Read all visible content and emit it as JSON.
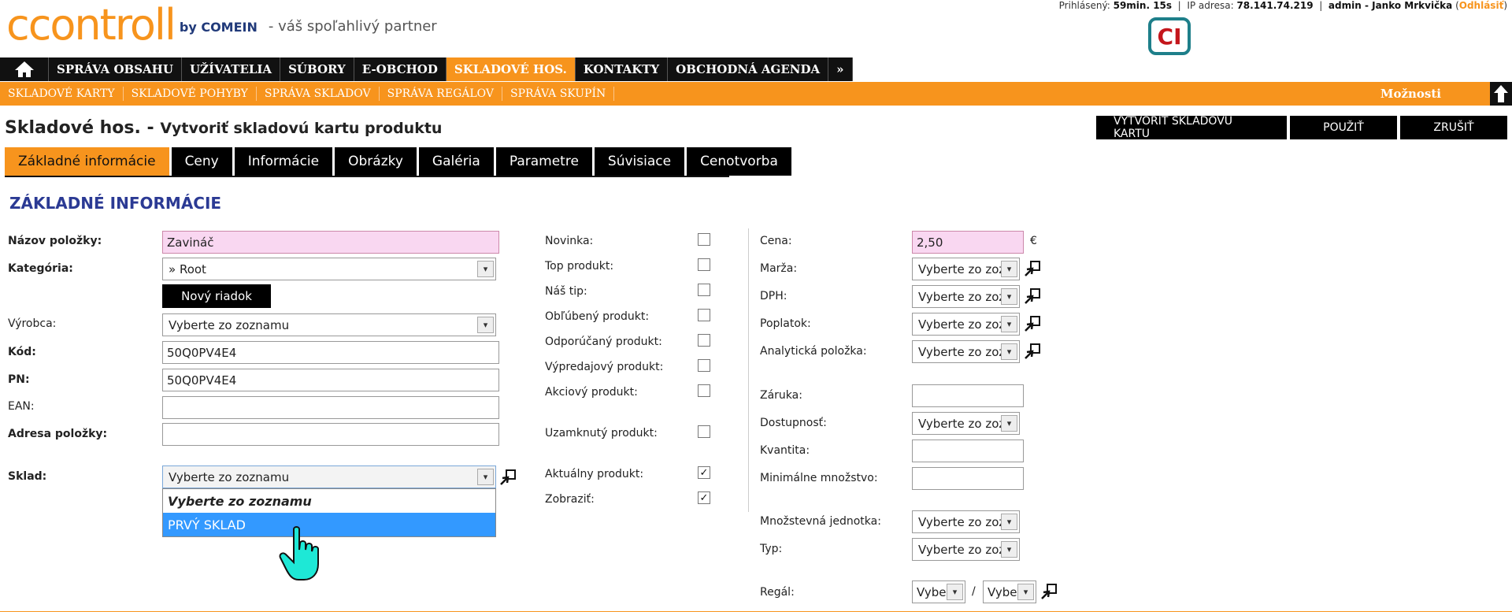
{
  "header": {
    "logo_main": "ccontroll",
    "logo_by": "by COMEIN",
    "slogan": "- váš spoľahlivý partner",
    "session_prefix": "Prihlásený:",
    "session_time": "59min. 15s",
    "ip_label": "IP adresa:",
    "ip_value": "78.141.74.219",
    "user_label": "admin - Janko Mrkvička",
    "logout": "Odhlásiť",
    "ci_logo": "CI"
  },
  "main_nav": [
    "SPRÁVA OBSAHU",
    "UŽÍVATELIA",
    "SÚBORY",
    "E-OBCHOD",
    "SKLADOVÉ HOS.",
    "KONTAKTY",
    "OBCHODNÁ AGENDA",
    "»"
  ],
  "sub_nav": [
    "SKLADOVÉ KARTY",
    "SKLADOVÉ POHYBY",
    "SPRÁVA SKLADOV",
    "SPRÁVA REGÁLOV",
    "SPRÁVA SKUPÍN"
  ],
  "options_label": "Možnosti",
  "page_title": {
    "main": "Skladové hos. -",
    "sub": "Vytvoriť skladovú kartu produktu"
  },
  "actions": {
    "create": "VYTVORIŤ SKLADOVÚ KARTU",
    "apply": "POUŽIŤ",
    "cancel": "ZRUŠIŤ"
  },
  "tabs": [
    "Základné informácie",
    "Ceny",
    "Informácie",
    "Obrázky",
    "Galéria",
    "Parametre",
    "Súvisiace",
    "Cenotvorba"
  ],
  "section_title": "ZÁKLADNÉ INFORMÁCIE",
  "left_form": {
    "name_label": "Názov položky:",
    "name_value": "Zavináč",
    "category_label": "Kategória:",
    "category_value": "» Root",
    "new_row_button": "Nový riadok",
    "manufacturer_label": "Výrobca:",
    "manufacturer_value": "Vyberte zo zoznamu",
    "code_label": "Kód:",
    "code_value": "50Q0PV4E4",
    "pn_label": "PN:",
    "pn_value": "50Q0PV4E4",
    "ean_label": "EAN:",
    "ean_value": "",
    "address_label": "Adresa položky:",
    "address_value": "",
    "warehouse_label": "Sklad:",
    "warehouse_value": "Vyberte zo zoznamu",
    "warehouse_options": [
      "Vyberte zo zoznamu",
      "PRVÝ SKLAD"
    ]
  },
  "flags": [
    {
      "label": "Novinka:",
      "checked": false
    },
    {
      "label": "Top produkt:",
      "checked": false
    },
    {
      "label": "Náš tip:",
      "checked": false
    },
    {
      "label": "Obľúbený produkt:",
      "checked": false
    },
    {
      "label": "Odporúčaný produkt:",
      "checked": false
    },
    {
      "label": "Výpredajový produkt:",
      "checked": false
    },
    {
      "label": "Akciový produkt:",
      "checked": false
    },
    {
      "label": "Uzamknutý produkt:",
      "checked": false
    },
    {
      "label": "Aktuálny produkt:",
      "checked": true
    },
    {
      "label": "Zobraziť:",
      "checked": true
    }
  ],
  "check_mark": "✓",
  "right_form": {
    "price_label": "Cena:",
    "price_value": "2,50",
    "currency": "€",
    "margin_label": "Marža:",
    "margin_value": "Vyberte zo zoz",
    "vat_label": "DPH:",
    "vat_value": "Vyberte zo zoz",
    "fee_label": "Poplatok:",
    "fee_value": "Vyberte zo zoz",
    "analytic_label": "Analytická položka:",
    "analytic_value": "Vyberte zo zoz",
    "warranty_label": "Záruka:",
    "warranty_value": "",
    "availability_label": "Dostupnosť:",
    "availability_value": "Vyberte zo zoz",
    "quantity_label": "Kvantita:",
    "quantity_value": "",
    "min_qty_label": "Minimálne množstvo:",
    "min_qty_value": "",
    "unit_label": "Množstevná jednotka:",
    "unit_value": "Vyberte zo zoz",
    "type_label": "Typ:",
    "type_value": "Vyberte zo zoz",
    "shelf_label": "Regál:",
    "shelf_value_1": "Vybe",
    "shelf_sep": "/",
    "shelf_value_2": "Vybe"
  }
}
